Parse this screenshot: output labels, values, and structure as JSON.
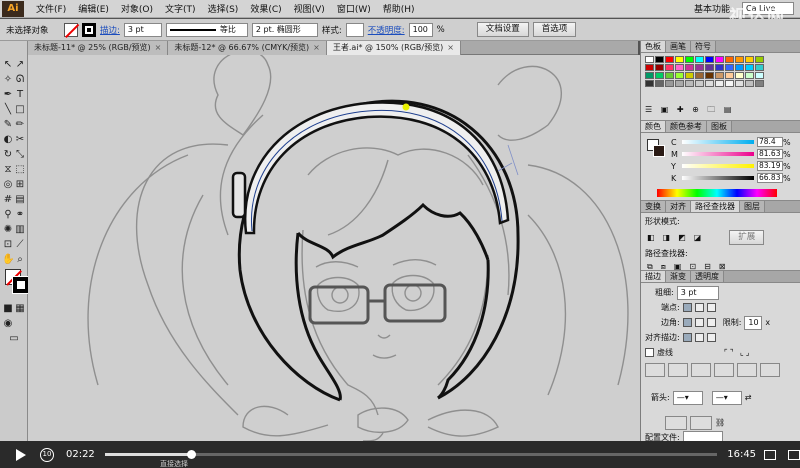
{
  "app": {
    "logo": "Ai",
    "menu": [
      "文件(F)",
      "编辑(E)",
      "对象(O)",
      "文字(T)",
      "选择(S)",
      "效果(C)",
      "视图(V)",
      "窗口(W)",
      "帮助(H)"
    ],
    "workspace": "基本功能",
    "search_placeholder": "Ca Live",
    "watermark": "视达网"
  },
  "control_bar": {
    "selection_label": "未选择对象",
    "stroke_label": "描边:",
    "stroke_weight": "3 pt",
    "profile_label": "等比",
    "brush_label": "2 pt. 椭圆形",
    "style_label": "样式:",
    "opacity_label": "不透明度:",
    "opacity_value": "100",
    "opacity_unit": "%",
    "doc_setup_button": "文档设置",
    "prefs_button": "首选项"
  },
  "document_tabs": [
    {
      "label": "未标题-11* @ 25% (RGB/预览)",
      "active": false
    },
    {
      "label": "未标题-12* @ 66.67% (CMYK/预览)",
      "active": false
    },
    {
      "label": "王者.ai* @ 150% (RGB/预览)",
      "active": true
    }
  ],
  "panels": {
    "swatches": {
      "tabs": [
        "色板",
        "画笔",
        "符号"
      ],
      "colors": [
        "#ffffff",
        "#000000",
        "#ff0000",
        "#ffff00",
        "#00ff00",
        "#00ffff",
        "#0000ff",
        "#ff00ff",
        "#ff6600",
        "#ff9900",
        "#ffcc00",
        "#99cc00",
        "#cc0000",
        "#990000",
        "#ff3366",
        "#ff66cc",
        "#cc3399",
        "#993399",
        "#663399",
        "#3333cc",
        "#3366ff",
        "#0099ff",
        "#00ccff",
        "#33cccc",
        "#009966",
        "#00cc66",
        "#66cc33",
        "#99ff33",
        "#cccc00",
        "#996633",
        "#663300",
        "#cc9966",
        "#ffcc99",
        "#ffffcc",
        "#ccffcc",
        "#ccffff",
        "#333333",
        "#666666",
        "#999999",
        "#aaaaaa",
        "#bbbbbb",
        "#cccccc",
        "#dddddd",
        "#eeeeee",
        "#f5f5f5",
        "#e0e0e0",
        "#c0c0c0",
        "#808080"
      ]
    },
    "color": {
      "tabs": [
        "颜色",
        "颜色参考",
        "图板"
      ],
      "channels": [
        {
          "label": "C",
          "value": "78.4",
          "color": "#00aeef"
        },
        {
          "label": "M",
          "value": "81.63",
          "color": "#ec008c"
        },
        {
          "label": "Y",
          "value": "83.19",
          "color": "#fff200"
        },
        {
          "label": "K",
          "value": "66.83",
          "color": "#000000"
        }
      ],
      "unit": "%"
    },
    "pathfinder": {
      "tabs": [
        "变换",
        "对齐",
        "路径查找器",
        "图层"
      ],
      "shape_modes_label": "形状模式:",
      "expand_button": "扩展",
      "pathfinders_label": "路径查找器:"
    },
    "stroke": {
      "tabs": [
        "描边",
        "渐变",
        "透明度"
      ],
      "weight_label": "粗细:",
      "weight_value": "3 pt",
      "cap_label": "端点:",
      "corner_label": "边角:",
      "limit_label": "限制:",
      "limit_value": "10",
      "limit_unit": "x",
      "align_label": "对齐描边:",
      "dashed_label": "虚线",
      "arrow_label": "箭头:",
      "profile_label": "配置文件:"
    }
  },
  "video": {
    "current_time": "02:22",
    "duration": "16:45",
    "progress": 0.141,
    "rewind_label": "10"
  },
  "status_bar": {
    "text": "直接选择"
  }
}
